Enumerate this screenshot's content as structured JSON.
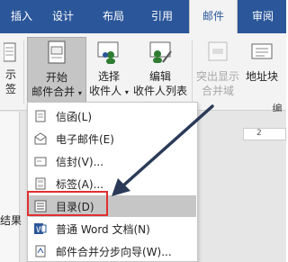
{
  "tabs": [
    {
      "label": "插入",
      "active": false
    },
    {
      "label": "设计",
      "active": false
    },
    {
      "label": "布局",
      "active": false
    },
    {
      "label": "引用",
      "active": false
    },
    {
      "label": "邮件",
      "active": true
    },
    {
      "label": "审阅",
      "active": false
    }
  ],
  "ribbon": {
    "left_partial_top": "示",
    "left_partial_bottom": "签",
    "start_merge": {
      "line1": "开始",
      "line2": "邮件合并"
    },
    "select_recipients": {
      "line1": "选择",
      "line2": "收件人"
    },
    "edit_recipients": {
      "line1": "编辑",
      "line2": "收件人列表"
    },
    "highlight_fields": {
      "line1": "突出显示",
      "line2": "合并域"
    },
    "address_block": {
      "line1": "地址块"
    },
    "group_fragment": "编"
  },
  "ruler": {
    "number": "2"
  },
  "pane": {
    "fragment": "结果"
  },
  "menu": {
    "items": [
      {
        "label": "信函(L)",
        "icon": "letter-icon"
      },
      {
        "label": "电子邮件(E)",
        "icon": "email-icon"
      },
      {
        "label": "信封(V)...",
        "icon": "envelope-icon"
      },
      {
        "label": "标签(A)...",
        "icon": "label-icon"
      },
      {
        "label": "目录(D)",
        "icon": "directory-icon",
        "highlighted": true
      },
      {
        "label": "普通 Word 文档(N)",
        "icon": "word-doc-icon"
      },
      {
        "label": "邮件合并分步向导(W)...",
        "icon": "wizard-icon"
      }
    ]
  },
  "colors": {
    "accent": "#2b579a",
    "highlight_border": "#e03030",
    "arrow": "#2a3a57"
  }
}
